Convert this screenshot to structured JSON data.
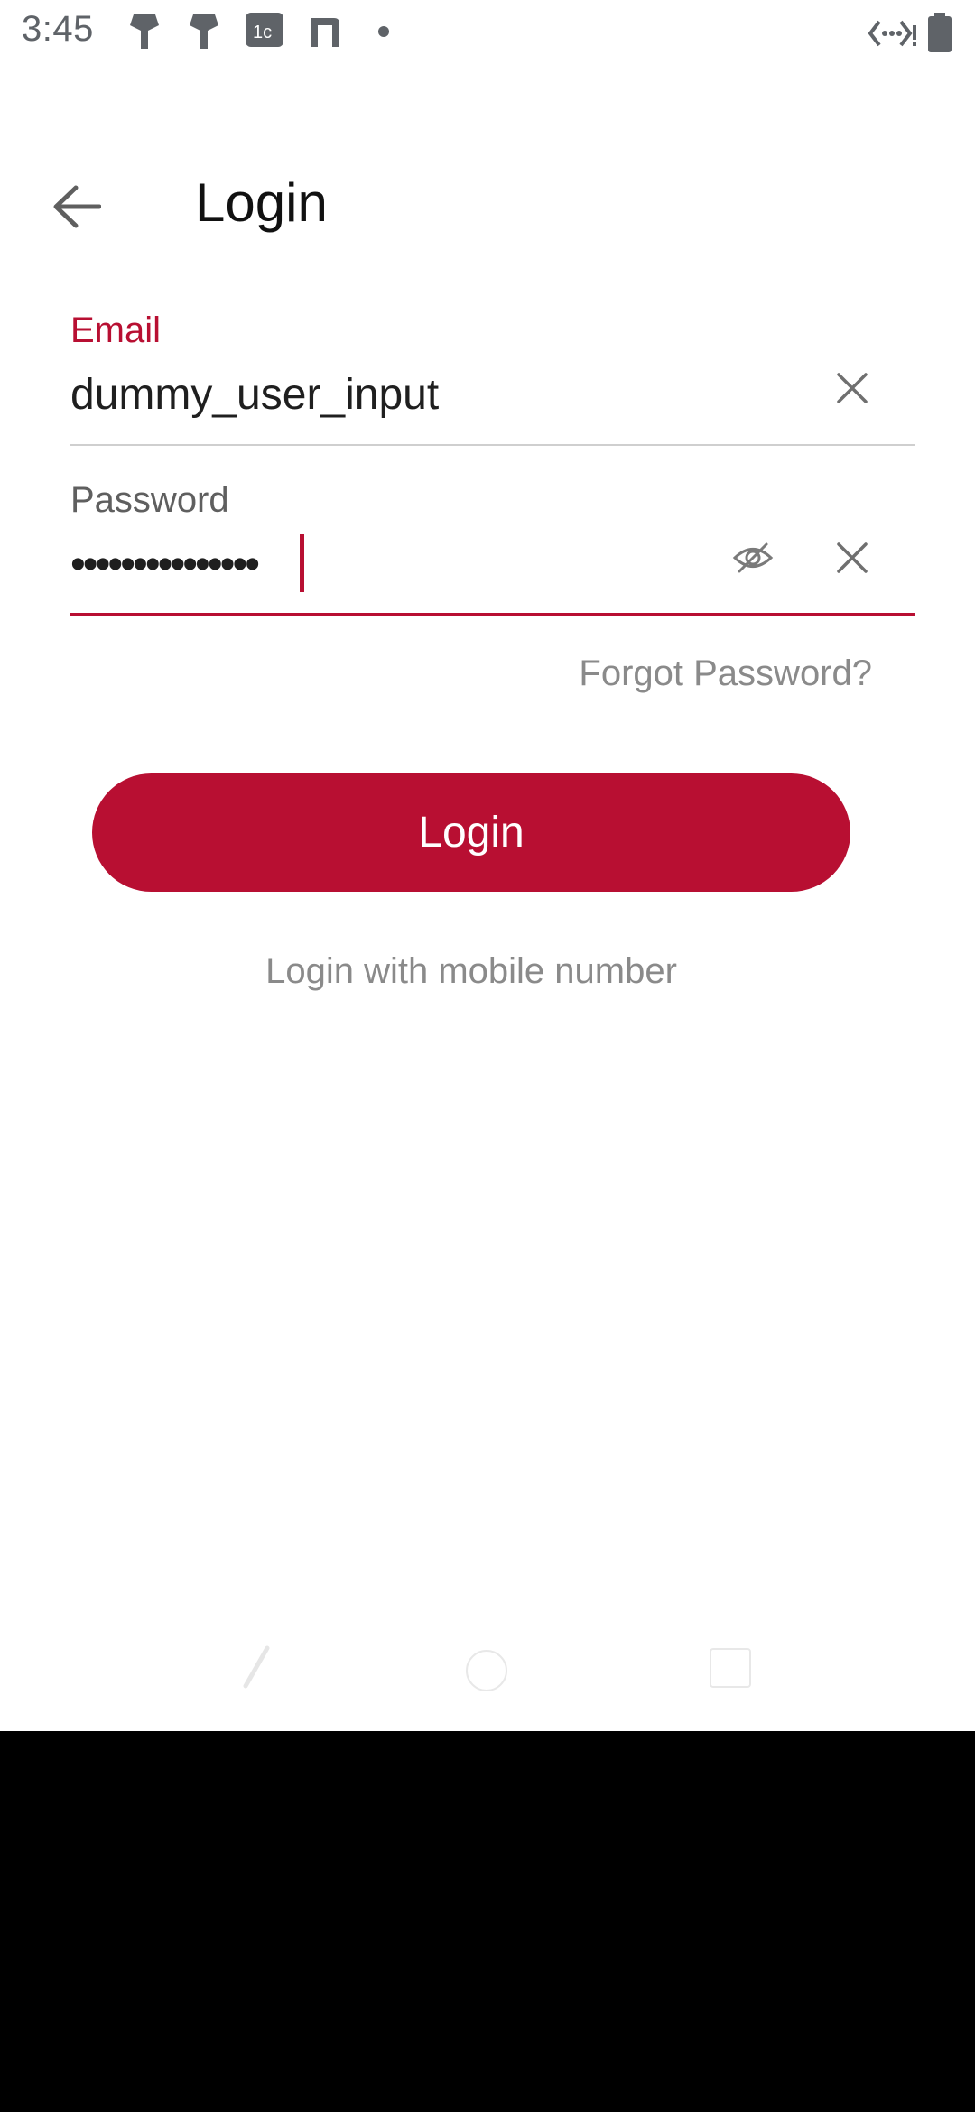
{
  "status_bar": {
    "time": "3:45",
    "icons": [
      "notification-icon",
      "notification-icon",
      "app-icon",
      "app-icon",
      "dot-icon",
      "network-icon",
      "battery-icon"
    ]
  },
  "app_bar": {
    "back_icon": "arrow-back-icon",
    "title": "Login"
  },
  "email": {
    "label": "Email",
    "value": "dummy_user_input",
    "clear_icon": "close-icon"
  },
  "password": {
    "label": "Password",
    "value": "•••••••••••••••",
    "visibility_icon": "eye-off-icon",
    "clear_icon": "close-icon"
  },
  "forgot_password": "Forgot Password?",
  "login_button": "Login",
  "mobile_login": "Login with mobile number",
  "colors": {
    "accent": "#b80f32",
    "muted_text": "#8a8a8a",
    "divider": "#cfcfcf"
  }
}
